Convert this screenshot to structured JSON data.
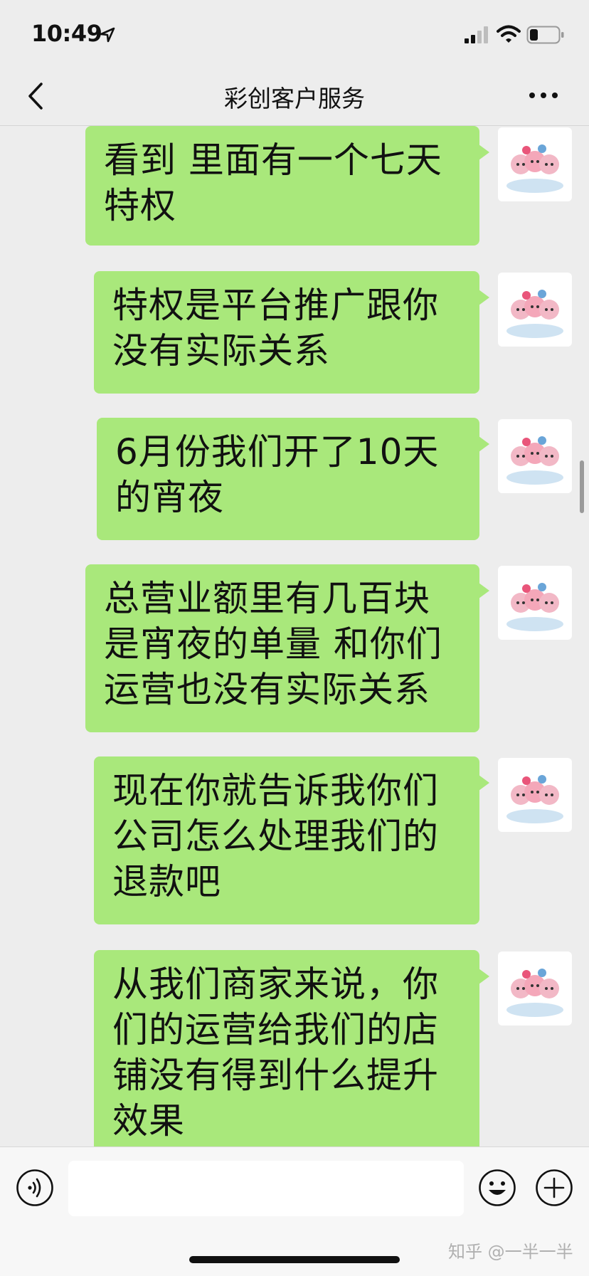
{
  "status_bar": {
    "time": "10:49",
    "icons": [
      "location-arrow-icon",
      "cellular-signal-icon",
      "wifi-icon",
      "battery-icon"
    ]
  },
  "nav": {
    "title": "彩创客户服务",
    "back_icon": "chevron-left-icon",
    "more_icon": "more-dots-icon"
  },
  "messages": [
    {
      "text": "看到 里面有一个七天\n特权"
    },
    {
      "text": "特权是平台推广跟你\n没有实际关系"
    },
    {
      "text": "6月份我们开了10天\n的宵夜"
    },
    {
      "text": "总营业额里有几百块\n是宵夜的单量 和你们\n运营也没有实际关系"
    },
    {
      "text": "现在你就告诉我你们\n公司怎么处理我们的\n退款吧"
    },
    {
      "text": "从我们商家来说，你\n们的运营给我们的店\n铺没有得到什么提升\n效果"
    }
  ],
  "input_bar": {
    "voice_icon": "voice-icon",
    "emoji_icon": "emoji-icon",
    "plus_icon": "plus-icon",
    "watermark": "知乎 @一半一半"
  },
  "colors": {
    "bubble": "#a9e87b",
    "background": "#ededed"
  }
}
